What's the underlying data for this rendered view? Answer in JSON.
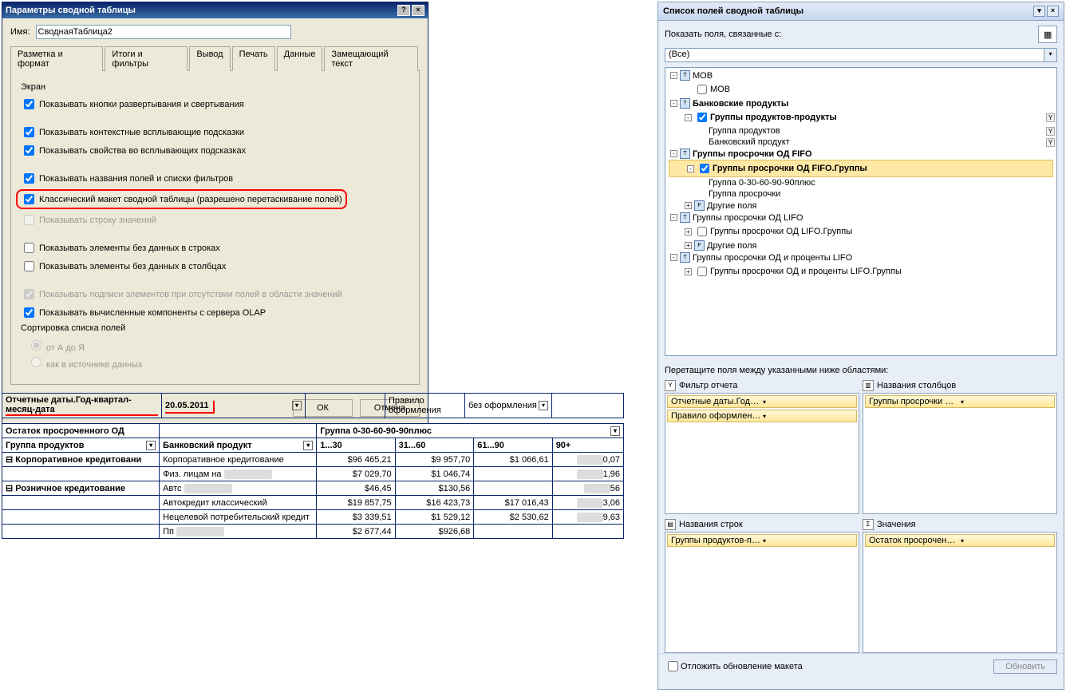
{
  "dialog": {
    "title": "Параметры сводной таблицы",
    "name_label": "Имя:",
    "name_value": "СводнаяТаблица2",
    "tabs": [
      "Разметка и формат",
      "Итоги и фильтры",
      "Вывод",
      "Печать",
      "Данные",
      "Замещающий текст"
    ],
    "section_screen": "Экран",
    "chk1": "Показывать кнопки развертывания и свертывания",
    "chk2": "Показывать контекстные всплывающие подсказки",
    "chk3": "Показывать свойства во всплывающих подсказках",
    "chk4": "Показывать названия полей и списки фильтров",
    "chk5": "Классический макет сводной таблицы (разрешено перетаскивание полей)",
    "chk6": "Показывать строку значений",
    "chk7": "Показывать элементы без данных в строках",
    "chk8": "Показывать элементы без данных в столбцах",
    "chk9": "Показывать подписи элементов при отсутствии полей в области значений",
    "chk10": "Показывать вычисленные компоненты с сервера OLAP",
    "section_sort": "Сортировка списка полей",
    "rad1": "от А до Я",
    "rad2": "как в источнике данных",
    "ok": "ОК",
    "cancel": "Отмена"
  },
  "pivot": {
    "filter1_label": "Отчетные даты.Год-квартал-месяц-дата",
    "filter1_value": "20.05.2011",
    "filter2_label": "Правило оформления",
    "filter2_value": "без оформления",
    "measure": "Остаток просроченного ОД",
    "col_header": "Группа 0-30-60-90-90плюс",
    "row_field": "Группа продуктов",
    "row_field2": "Банковский продукт",
    "cols": [
      "1...30",
      "31...60",
      "61...90",
      "90+"
    ],
    "rows": [
      {
        "g": "Корпоративное кредитовани",
        "p": "Корпоративное кредитование",
        "v": [
          "$96 465,21",
          "$9 957,70",
          "$1 066,61",
          "0,07"
        ]
      },
      {
        "g": "",
        "p": "Физ. лицам на",
        "v": [
          "$7 029,70",
          "$1 046,74",
          "",
          "1,96"
        ]
      },
      {
        "g": "Розничное кредитование",
        "p": "Автс",
        "v": [
          "$46,45",
          "$130,56",
          "",
          "56"
        ]
      },
      {
        "g": "",
        "p": "Автокредит классический",
        "v": [
          "$19 857,75",
          "$16 423,73",
          "$17 016,43",
          "3,06"
        ]
      },
      {
        "g": "",
        "p": "Нецелевой потребительский кредит",
        "v": [
          "$3 339,51",
          "$1 529,12",
          "$2 530,62",
          "9,63"
        ]
      },
      {
        "g": "",
        "p": "Пп",
        "v": [
          "$2 677,44",
          "$926,68",
          "",
          ""
        ]
      }
    ]
  },
  "panel": {
    "title": "Список полей сводной таблицы",
    "show_label": "Показать поля, связанные с:",
    "combo": "(Все)",
    "tree": [
      {
        "lvl": 0,
        "exp": "-",
        "ico": "T",
        "chk": null,
        "bold": false,
        "lbl": "МОВ"
      },
      {
        "lvl": 1,
        "exp": null,
        "ico": null,
        "chk": false,
        "bold": false,
        "lbl": "МОВ"
      },
      {
        "lvl": 0,
        "exp": "-",
        "ico": "T",
        "chk": null,
        "bold": true,
        "lbl": "Банковские продукты"
      },
      {
        "lvl": 1,
        "exp": "-",
        "ico": null,
        "chk": true,
        "bold": true,
        "lbl": "Группы продуктов-продукты",
        "filt": true
      },
      {
        "lvl": 2,
        "exp": null,
        "ico": null,
        "chk": null,
        "bold": false,
        "lbl": "Группа продуктов",
        "filt": true
      },
      {
        "lvl": 2,
        "exp": null,
        "ico": null,
        "chk": null,
        "bold": false,
        "lbl": "Банковский продукт",
        "filt": true
      },
      {
        "lvl": 0,
        "exp": "-",
        "ico": "T",
        "chk": null,
        "bold": true,
        "lbl": "Группы просрочки ОД FIFO"
      },
      {
        "lvl": 1,
        "exp": "-",
        "ico": null,
        "chk": true,
        "bold": true,
        "lbl": "Группы просрочки ОД FIFO.Группы",
        "sel": true
      },
      {
        "lvl": 2,
        "exp": null,
        "ico": null,
        "chk": null,
        "bold": false,
        "lbl": "Группа 0-30-60-90-90плюс"
      },
      {
        "lvl": 2,
        "exp": null,
        "ico": null,
        "chk": null,
        "bold": false,
        "lbl": "Группа просрочки"
      },
      {
        "lvl": 1,
        "exp": "+",
        "ico": "F",
        "chk": null,
        "bold": false,
        "lbl": "Другие поля"
      },
      {
        "lvl": 0,
        "exp": "-",
        "ico": "T",
        "chk": null,
        "bold": false,
        "lbl": "Группы просрочки ОД LIFO"
      },
      {
        "lvl": 1,
        "exp": "+",
        "ico": null,
        "chk": false,
        "bold": false,
        "lbl": "Группы просрочки ОД LIFO.Группы"
      },
      {
        "lvl": 1,
        "exp": "+",
        "ico": "F",
        "chk": null,
        "bold": false,
        "lbl": "Другие поля"
      },
      {
        "lvl": 0,
        "exp": "-",
        "ico": "T",
        "chk": null,
        "bold": false,
        "lbl": "Группы просрочки ОД и проценты LIFO"
      },
      {
        "lvl": 1,
        "exp": "+",
        "ico": null,
        "chk": false,
        "bold": false,
        "lbl": "Группы просрочки ОД и проценты LIFO.Группы"
      }
    ],
    "drag_label": "Перетащите поля между указанными ниже областями:",
    "area_filter": "Фильтр отчета",
    "area_cols": "Названия столбцов",
    "area_rows": "Названия строк",
    "area_vals": "Значения",
    "pills_filter": [
      "Отчетные даты.Год-квартал-месяц-дата",
      "Правило оформления"
    ],
    "pills_cols": [
      "Группы просрочки ОД FIFO.Группы"
    ],
    "pills_rows": [
      "Группы продуктов-продукты"
    ],
    "pills_vals": [
      "Остаток просроченного ОД"
    ],
    "defer": "Отложить обновление макета",
    "update": "Обновить"
  }
}
